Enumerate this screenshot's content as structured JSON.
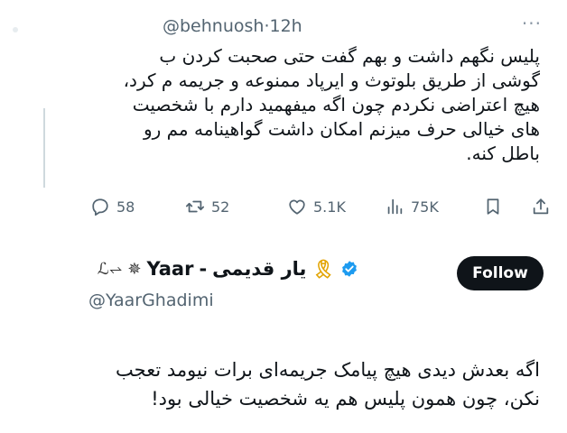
{
  "quoted_tweet": {
    "handle": "@behnuosh",
    "separator": "·",
    "time": "12h",
    "more": "···",
    "lines": [
      "پلیس نگهم داشت و بهم گفت حتی صحبت کردن ب",
      "گوشی از طریق بلوتوث و ایرپاد ممنوعه و جریمه م کرد،",
      "هیچ اعتراضی نکردم چون اگه میفهمید دارم با شخصیت",
      "های خیالی حرف میزنم امکان داشت گواهینامه مم رو",
      "باطل کنه."
    ],
    "actions": {
      "replies": "58",
      "retweets": "52",
      "likes": "5.1K",
      "views": "75K"
    }
  },
  "author": {
    "name_latin": "Yaar",
    "name_persian": "یار قدیمی",
    "dash": "-",
    "decor_left": "ℒ⥋",
    "decor_star": "✵",
    "ribbon": "🎗",
    "handle": "@YaarGhadimi",
    "follow_label": "Follow"
  },
  "tweet": {
    "lines": [
      "اگه بعدش دیدی هیچ پیامک جریمه‌ای برات نیومد تعجب",
      "نکن، چون همون پلیس هم یه شخصیت خیالی بود!"
    ]
  },
  "colors": {
    "text": "#0f1419",
    "secondary": "#536471",
    "verified": "#1d9bf0",
    "follow_bg": "#0f1419"
  }
}
